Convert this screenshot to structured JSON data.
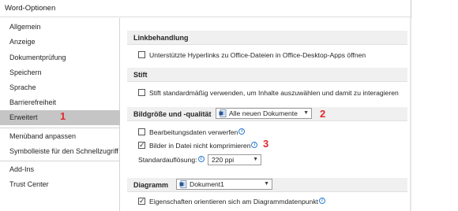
{
  "window": {
    "title": "Word-Optionen"
  },
  "nav": {
    "items": [
      {
        "label": "Allgemein"
      },
      {
        "label": "Anzeige"
      },
      {
        "label": "Dokumentprüfung"
      },
      {
        "label": "Speichern"
      },
      {
        "label": "Sprache"
      },
      {
        "label": "Barrierefreiheit"
      },
      {
        "label": "Erweitert",
        "selected": true
      },
      {
        "label": "Menüband anpassen"
      },
      {
        "label": "Symbolleiste für den Schnellzugriff"
      },
      {
        "label": "Add-Ins"
      },
      {
        "label": "Trust Center"
      }
    ]
  },
  "sections": {
    "links": {
      "title": "Linkbehandlung",
      "hyperlinks_label": "Unterstützte Hyperlinks zu Office-Dateien in Office-Desktop-Apps öffnen",
      "hyperlinks_checked": false
    },
    "pen": {
      "title": "Stift",
      "pen_label": "Stift standardmäßig verwenden, um Inhalte auszuwählen und damit zu interagieren",
      "pen_checked": false
    },
    "image": {
      "title": "Bildgröße und -qualität",
      "scope_value": "Alle neuen Dokumente",
      "discard_label": "Bearbeitungsdaten verwerfen",
      "discard_checked": false,
      "nocompress_label": "Bilder in Datei nicht komprimieren",
      "nocompress_checked": true,
      "resolution_label": "Standardauflösung:",
      "resolution_value": "220 ppi"
    },
    "chart": {
      "title": "Diagramm",
      "scope_value": "Dokument1",
      "props_label": "Eigenschaften orientieren sich am Diagrammdatenpunkt",
      "props_checked": true
    }
  },
  "annotations": {
    "a1": "1",
    "a2": "2",
    "a3": "3",
    "color": "#e0282e"
  },
  "icons": {
    "checkmark": "✓",
    "info": "i",
    "dropdown_arrow": "▼",
    "document": "document-icon"
  }
}
